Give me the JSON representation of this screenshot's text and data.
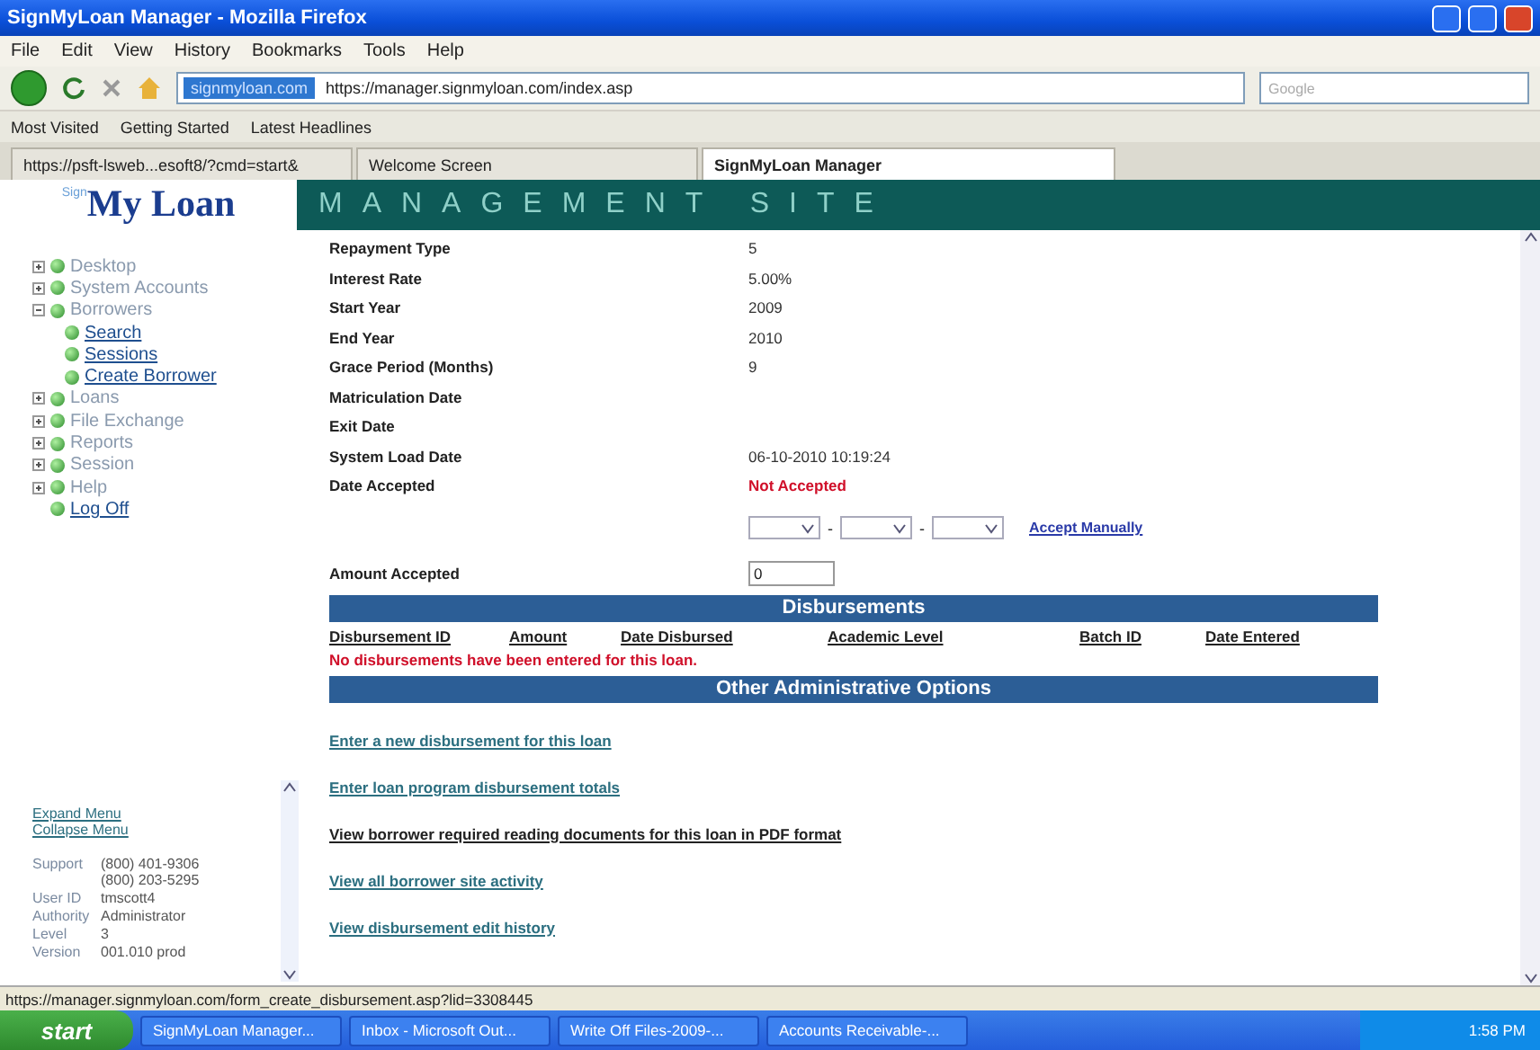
{
  "window": {
    "title": "SignMyLoan Manager - Mozilla Firefox"
  },
  "menu": [
    "File",
    "Edit",
    "View",
    "History",
    "Bookmarks",
    "Tools",
    "Help"
  ],
  "address_bar": {
    "identity": "signmyloan.com",
    "url": "https://manager.signmyloan.com/index.asp"
  },
  "search": {
    "placeholder": "Google"
  },
  "bookmarks": [
    "Most Visited",
    "Getting Started",
    "Latest Headlines"
  ],
  "tabs": [
    {
      "label": "https://psft-lsweb...esoft8/?cmd=start&",
      "selected": false
    },
    {
      "label": "Welcome Screen",
      "selected": false
    },
    {
      "label": "SignMyLoan Manager",
      "selected": true
    }
  ],
  "site": {
    "logo_small": "Sign",
    "logo": "My Loan",
    "banner": "MANAGEMENT SITE"
  },
  "sidebar": {
    "tree": [
      {
        "label": "Desktop",
        "kind": "folder",
        "expanded": false
      },
      {
        "label": "System Accounts",
        "kind": "folder",
        "expanded": false
      },
      {
        "label": "Borrowers",
        "kind": "folder",
        "expanded": true,
        "children": [
          {
            "label": "Search",
            "kind": "link"
          },
          {
            "label": "Sessions",
            "kind": "link"
          },
          {
            "label": "Create Borrower",
            "kind": "link"
          }
        ]
      },
      {
        "label": "Loans",
        "kind": "folder",
        "expanded": false
      },
      {
        "label": "File Exchange",
        "kind": "folder",
        "expanded": false
      },
      {
        "label": "Reports",
        "kind": "folder",
        "expanded": false
      },
      {
        "label": "Session",
        "kind": "folder",
        "expanded": false
      },
      {
        "label": "Help",
        "kind": "folder",
        "expanded": false
      },
      {
        "label": "Log Off",
        "kind": "link"
      }
    ],
    "menu_links": [
      "Expand Menu",
      "Collapse Menu"
    ],
    "info": [
      {
        "label": "Support",
        "values": [
          "(800) 401-9306",
          "(800) 203-5295"
        ]
      },
      {
        "label": "User ID",
        "values": [
          "tmscott4"
        ]
      },
      {
        "label": "Authority",
        "values": [
          "Administrator"
        ]
      },
      {
        "label": "Level",
        "values": [
          "3"
        ]
      },
      {
        "label": "Version",
        "values": [
          "001.010  prod"
        ]
      }
    ]
  },
  "fields": [
    {
      "label": "Repayment Type",
      "value": "5",
      "kind": "text"
    },
    {
      "label": "Interest Rate",
      "value": "5.00%",
      "kind": "text"
    },
    {
      "label": "Start Year",
      "value": "2009",
      "kind": "text"
    },
    {
      "label": "End Year",
      "value": "2010",
      "kind": "text"
    },
    {
      "label": "Grace Period (Months)",
      "value": "9",
      "kind": "text"
    },
    {
      "label": "Matriculation Date"
    },
    {
      "label": "Exit Date"
    },
    {
      "label": "System Load Date",
      "value": "06-10-2010 10:19:24",
      "kind": "text"
    },
    {
      "label": "Date Accepted",
      "value": "Not Accepted",
      "kind": "alert"
    }
  ],
  "accept": {
    "link": "Accept Manually",
    "separators": [
      "-",
      "-"
    ]
  },
  "amount": {
    "label": "Amount Accepted",
    "value": "0"
  },
  "disbursements": {
    "title": "Disbursements",
    "columns": [
      "Disbursement ID",
      "Amount",
      "Date Disbursed",
      "Academic Level",
      "Batch ID",
      "Date Entered"
    ],
    "empty": "No disbursements have been entered for this loan."
  },
  "options": {
    "title": "Other Administrative Options",
    "links": [
      "Enter a new disbursement for this loan",
      "Enter loan program disbursement totals",
      "View borrower required reading documents for this loan in PDF format",
      "View all borrower site activity",
      "View disbursement edit history"
    ]
  },
  "status_bar": "https://manager.signmyloan.com/form_create_disbursement.asp?lid=3308445",
  "taskbar": {
    "start": "start",
    "tasks": [
      "SignMyLoan Manager...",
      "Inbox - Microsoft Out...",
      "Write Off Files-2009-...",
      "Accounts Receivable-..."
    ],
    "time": "1:58 PM"
  }
}
